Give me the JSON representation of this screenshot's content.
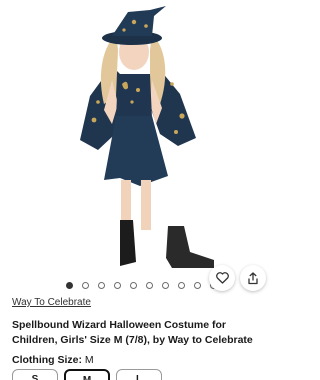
{
  "product": {
    "brand_link": "Way To Celebrate",
    "title": "Spellbound Wizard Halloween Costume for Children, Girls' Size M (7/8), by Way to Celebrate"
  },
  "carousel": {
    "total": 10,
    "active_index": 0
  },
  "actions": {
    "favorite_icon": "heart-icon",
    "share_icon": "share-icon"
  },
  "options": {
    "size_label": "Clothing Size:",
    "size_value": "M",
    "sizes": [
      "S",
      "M",
      "L"
    ],
    "selected_size": "M"
  },
  "colors": {
    "costume_navy": "#1f3550",
    "star_gold": "#c9a75a",
    "dot_active": "#333333"
  }
}
